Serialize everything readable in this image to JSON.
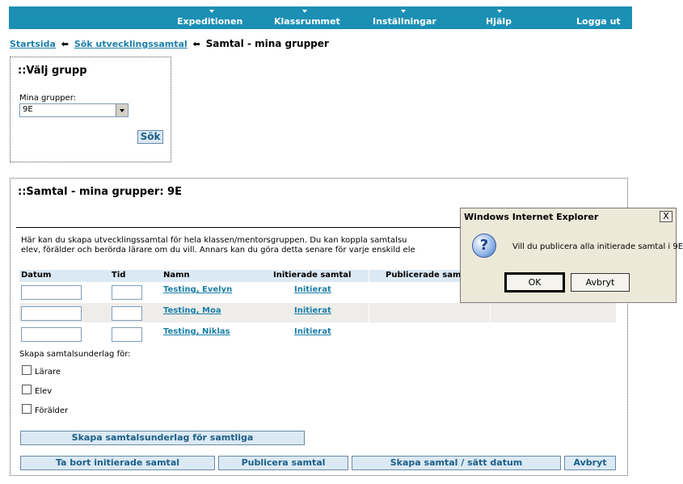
{
  "nav": {
    "items": [
      {
        "label": "Expeditionen"
      },
      {
        "label": "Klassrummet"
      },
      {
        "label": "Inställningar"
      },
      {
        "label": "Hjälp"
      },
      {
        "label": "Logga ut"
      }
    ]
  },
  "breadcrumb": {
    "home": "Startsida",
    "search": "Sök utvecklingssamtal",
    "current": "Samtal - mina grupper"
  },
  "group_select": {
    "title": "::Välj grupp",
    "label": "Mina grupper:",
    "selected": "9E",
    "search_button": "Sök"
  },
  "main": {
    "title": "::Samtal - mina grupper: 9E",
    "intro_line1": "Här kan du skapa utvecklingssamtal för hela klassen/mentorsgruppen. Du kan koppla samtalsu",
    "intro_line2": "elev, förälder och berörda lärare om du vill. Annars kan du göra detta senare för varje enskild ele",
    "columns": {
      "date": "Datum",
      "time": "Tid",
      "name": "Namn",
      "initiated": "Initierade samtal",
      "published": "Publicerade sam"
    },
    "rows": [
      {
        "name": "Testing, Evelyn",
        "status": "Initierat"
      },
      {
        "name": "Testing, Moa",
        "status": "Initierat"
      },
      {
        "name": "Testing, Niklas",
        "status": "Initierat"
      }
    ],
    "create_for_label": "Skapa samtalsunderlag för:",
    "checkboxes": [
      {
        "label": "Lärare"
      },
      {
        "label": "Elev"
      },
      {
        "label": "Förälder"
      }
    ],
    "create_all_button": "Skapa samtalsunderlag för samtliga",
    "buttons": {
      "remove": "Ta bort initierade samtal",
      "publish": "Publicera samtal",
      "create": "Skapa samtal / sätt datum",
      "cancel": "Avbryt"
    }
  },
  "dialog": {
    "title": "Windows Internet Explorer",
    "close": "X",
    "icon": "question-icon",
    "message": "Vill du publicera alla initierade samtal i 9E",
    "ok": "OK",
    "cancel": "Avbryt"
  }
}
